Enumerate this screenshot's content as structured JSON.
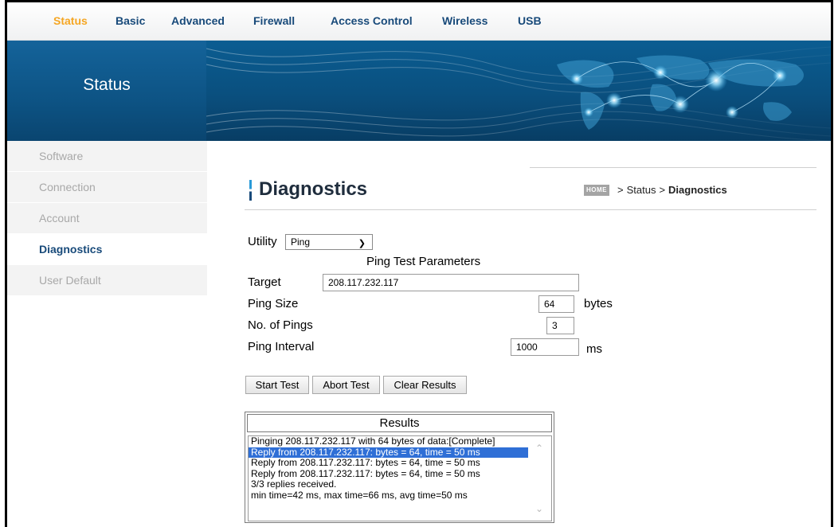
{
  "nav": {
    "items": [
      {
        "label": "Status",
        "active": true
      },
      {
        "label": "Basic",
        "active": false
      },
      {
        "label": "Advanced",
        "active": false
      },
      {
        "label": "Firewall",
        "active": false
      },
      {
        "label": "Access Control",
        "active": false
      },
      {
        "label": "Wireless",
        "active": false
      },
      {
        "label": "USB",
        "active": false
      }
    ]
  },
  "banner": {
    "title": "Status"
  },
  "sidebar": {
    "items": [
      {
        "label": "Software",
        "active": false
      },
      {
        "label": "Connection",
        "active": false
      },
      {
        "label": "Account",
        "active": false
      },
      {
        "label": "Diagnostics",
        "active": true
      },
      {
        "label": "User Default",
        "active": false
      }
    ]
  },
  "page": {
    "title": "Diagnostics",
    "breadcrumb": {
      "home": "HOME",
      "sep": ">",
      "parent": "Status",
      "current": "Diagnostics"
    }
  },
  "form": {
    "utility_label": "Utility",
    "utility_value": "Ping",
    "section_title": "Ping Test Parameters",
    "target_label": "Target",
    "target_value": "208.117.232.117",
    "ping_size_label": "Ping Size",
    "ping_size_value": "64",
    "ping_size_unit": "bytes",
    "num_pings_label": "No. of Pings",
    "num_pings_value": "3",
    "interval_label": "Ping Interval",
    "interval_value": "1000",
    "interval_unit": "ms"
  },
  "buttons": {
    "start": "Start Test",
    "abort": "Abort Test",
    "clear": "Clear Results"
  },
  "results": {
    "title": "Results",
    "lines": [
      "Pinging 208.117.232.117 with 64 bytes of data:[Complete]",
      "Reply from 208.117.232.117: bytes = 64, time = 50 ms",
      "Reply from 208.117.232.117: bytes = 64, time = 50 ms",
      "Reply from 208.117.232.117: bytes = 64, time = 50 ms",
      "3/3 replies received.",
      "min time=42 ms, max time=66 ms, avg time=50 ms"
    ],
    "selected_index": 1
  },
  "colors": {
    "nav_text": "#184a7a",
    "nav_active": "#f5a623",
    "banner": "#0a4f7e",
    "selection": "#2f6fd6"
  }
}
